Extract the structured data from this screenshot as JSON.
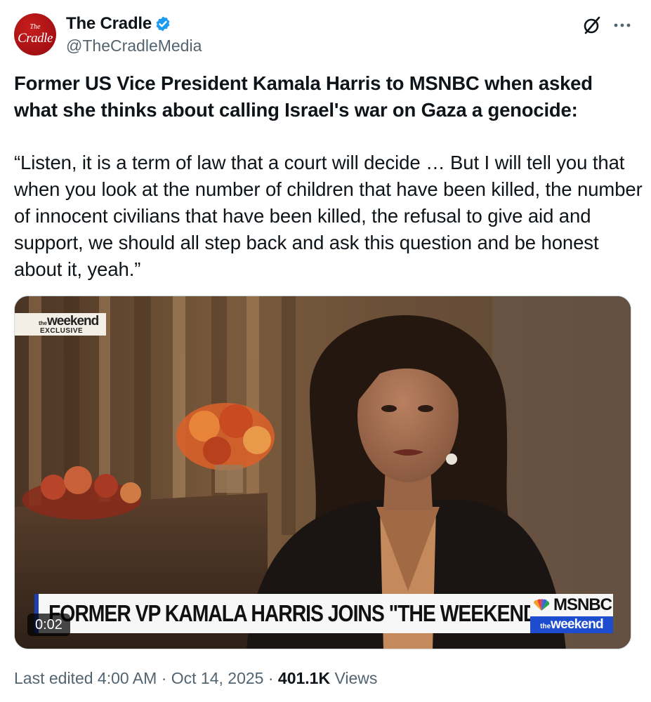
{
  "author": {
    "name": "The Cradle",
    "handle": "@TheCradleMedia",
    "avatar_text_top": "The",
    "avatar_text_main": "Cradle",
    "verified": true,
    "verified_color": "#1d9bf0"
  },
  "post": {
    "title": "Former US Vice President Kamala Harris to MSNBC when asked what she thinks about calling Israel's war on Gaza a genocide:",
    "quote": "“Listen, it is a term of law that a court will decide … But I will tell you that when you look at the number of children that have been killed, the number of innocent civilians that have been killed, the refusal to give aid and support, we should all step back and ask this question and be honest about it, yeah.”"
  },
  "video": {
    "exclusive_brand_small": "the",
    "exclusive_brand": "weekend",
    "exclusive_label": "EXCLUSIVE",
    "lower_third": "FORMER VP KAMALA HARRIS JOINS \"THE WEEKEND\"",
    "network": "MSNBC",
    "show_small": "the",
    "show": "weekend",
    "timer": "0:02"
  },
  "meta": {
    "edited": "Last edited 4:00 AM",
    "sep1": " · ",
    "date": "Oct 14, 2025",
    "sep2": " · ",
    "views_count": "401.1K",
    "views_label": " Views"
  },
  "icons": {
    "grok": "grok-icon",
    "more": "more-icon",
    "verified": "verified-badge-icon"
  },
  "colors": {
    "text": "#0f1419",
    "secondary": "#536471",
    "brand_red": "#a50f12",
    "msnbc_blue": "#1d4ccf"
  }
}
